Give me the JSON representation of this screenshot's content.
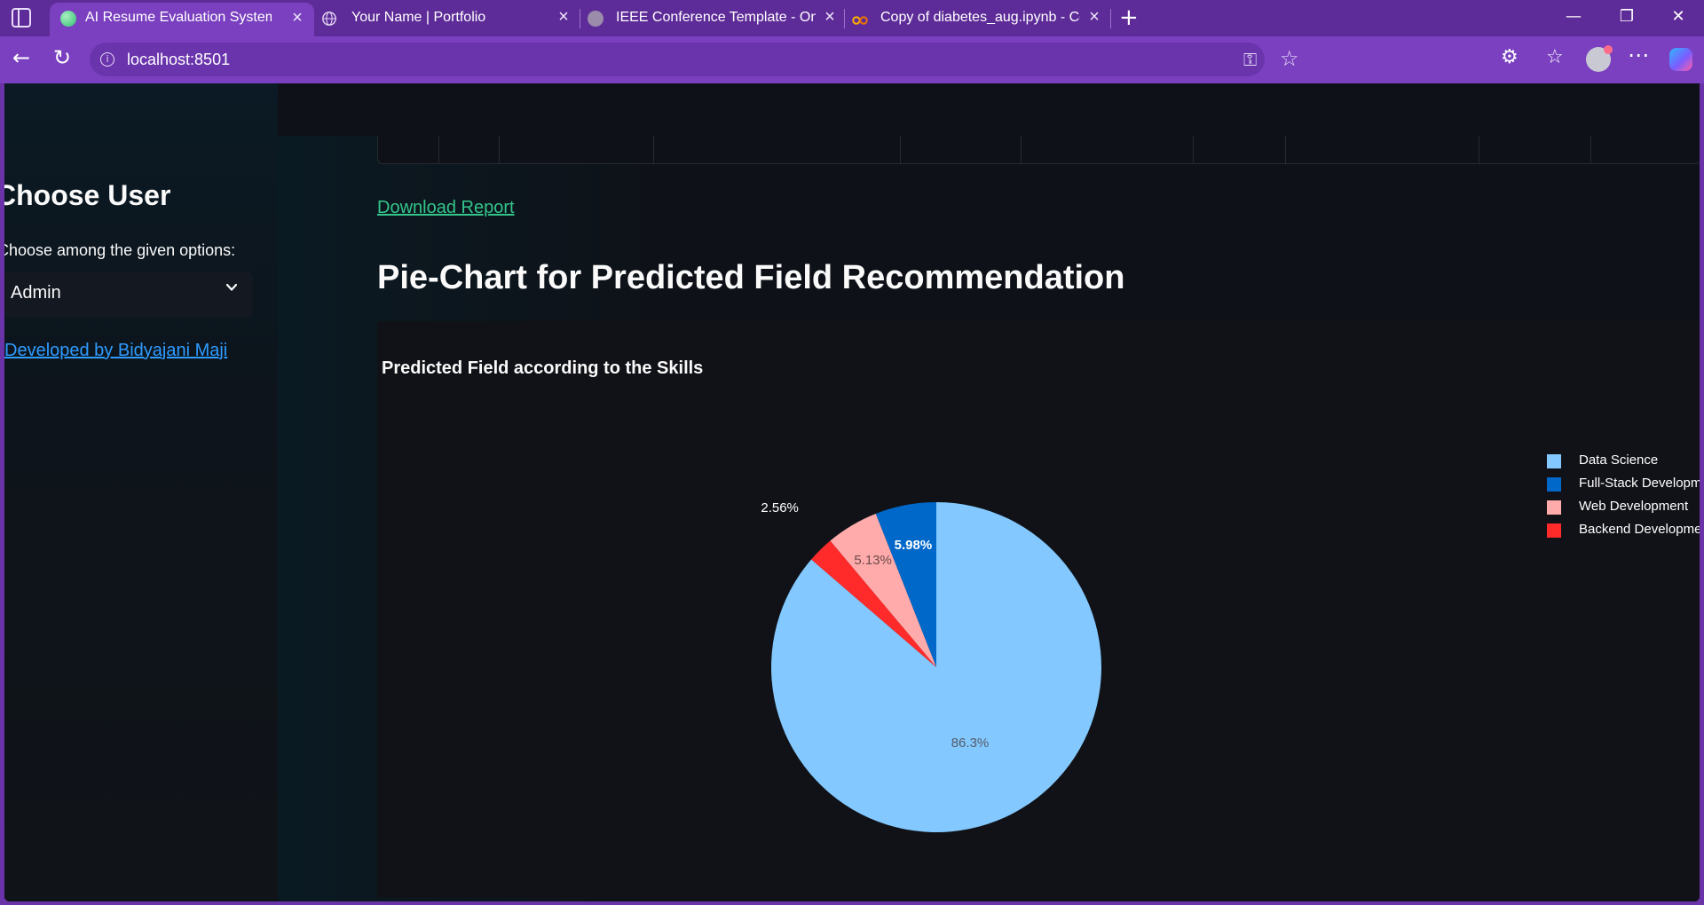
{
  "browser": {
    "tabs": [
      {
        "title": "AI Resume Evaluation System",
        "active": true,
        "favicon": "streamlit-icon"
      },
      {
        "title": "Your Name | Portfolio",
        "active": false,
        "favicon": "globe-icon"
      },
      {
        "title": "IEEE Conference Template - Onlin",
        "active": false,
        "favicon": "overleaf-icon"
      },
      {
        "title": "Copy of diabetes_aug.ipynb - Col",
        "active": false,
        "favicon": "colab-icon"
      }
    ],
    "url": "localhost:8501"
  },
  "sidebar": {
    "title": "Choose User",
    "label": "Choose among the given options:",
    "selected": "Admin",
    "link": "Developed by Bidyajani Maji"
  },
  "main": {
    "download_link": "Download Report",
    "heading": "Pie-Chart for Predicted Field Recommendation"
  },
  "chart_data": {
    "type": "pie",
    "title": "Predicted Field according to the Skills",
    "labels": [
      "Data Science",
      "Full-Stack Developme",
      "Web Development",
      "Backend Developmer"
    ],
    "values": [
      86.3,
      5.98,
      5.13,
      2.56
    ],
    "value_labels": [
      "86.3%",
      "5.98%",
      "5.13%",
      "2.56%"
    ],
    "colors": [
      "#83c9ff",
      "#0068c9",
      "#ffabab",
      "#ff2b2b"
    ],
    "legend": "right"
  },
  "colors": {
    "link_green": "#33c58a",
    "link_blue": "#2e9bff",
    "browser_purple": "#7a40c0"
  }
}
